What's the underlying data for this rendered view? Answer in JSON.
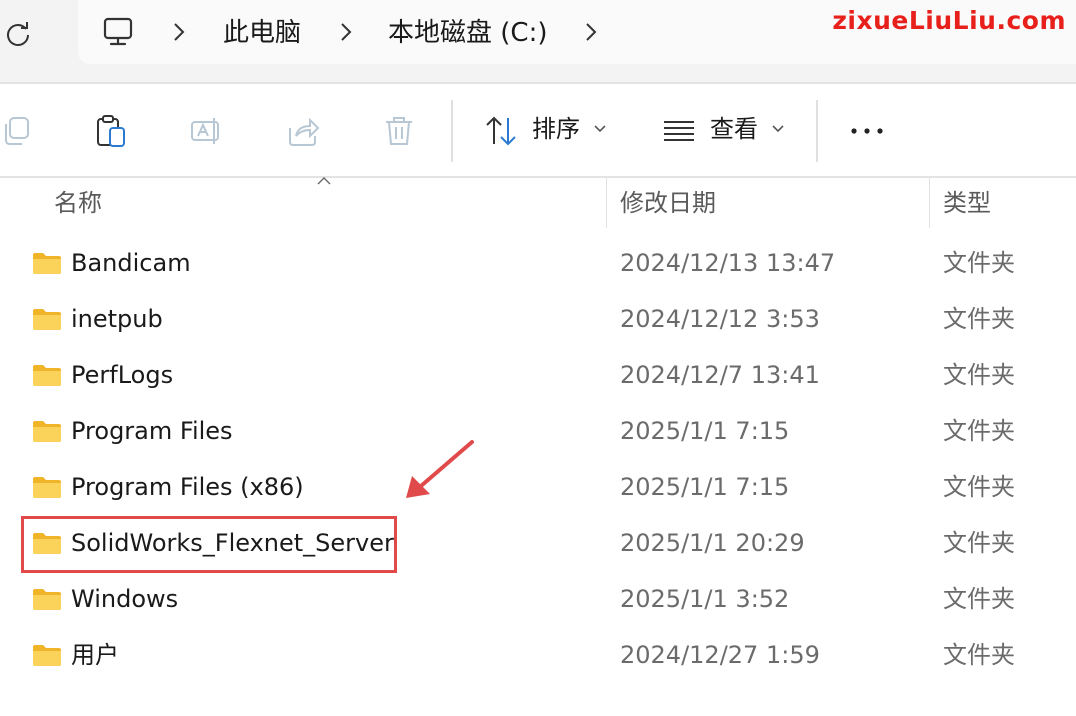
{
  "watermark": "zixueLiuLiu.com",
  "breadcrumb": {
    "items": [
      "此电脑",
      "本地磁盘 (C:)"
    ]
  },
  "toolbar": {
    "sort_label": "排序",
    "view_label": "查看"
  },
  "columns": {
    "name": "名称",
    "modified": "修改日期",
    "type": "类型"
  },
  "files": [
    {
      "name": "Bandicam",
      "modified": "2024/12/13 13:47",
      "type": "文件夹"
    },
    {
      "name": "inetpub",
      "modified": "2024/12/12 3:53",
      "type": "文件夹"
    },
    {
      "name": "PerfLogs",
      "modified": "2024/12/7 13:41",
      "type": "文件夹"
    },
    {
      "name": "Program Files",
      "modified": "2025/1/1 7:15",
      "type": "文件夹"
    },
    {
      "name": "Program Files (x86)",
      "modified": "2025/1/1 7:15",
      "type": "文件夹"
    },
    {
      "name": "SolidWorks_Flexnet_Server",
      "modified": "2025/1/1 20:29",
      "type": "文件夹"
    },
    {
      "name": "Windows",
      "modified": "2025/1/1 3:52",
      "type": "文件夹"
    },
    {
      "name": "用户",
      "modified": "2024/12/27 1:59",
      "type": "文件夹"
    }
  ],
  "colors": {
    "highlight": "#e04a4a",
    "watermark": "#e8201c",
    "folder": "#f7c948"
  }
}
